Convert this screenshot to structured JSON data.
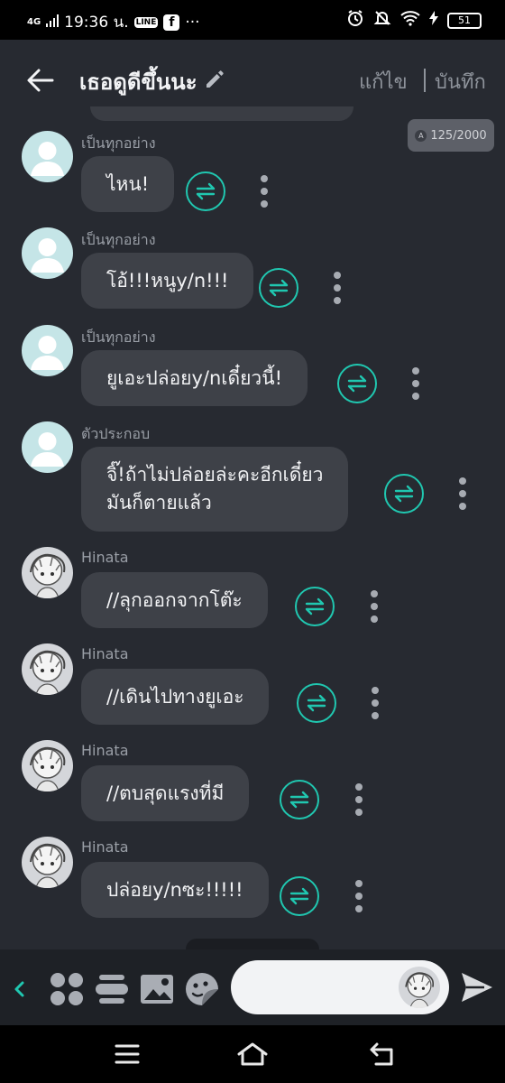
{
  "status_bar": {
    "network": "4G",
    "time": "19:36 น.",
    "line_badge": "LINE",
    "fb_badge": "f",
    "more": "···",
    "battery": "51"
  },
  "header": {
    "title": "เธอดูดีขึ้นนะ",
    "edit_label": "แก้ไข",
    "save_label": "บันทึก"
  },
  "counter": {
    "badge": "A",
    "text": "125/2000"
  },
  "messages": [
    {
      "sender": "เป็นทุกอย่าง",
      "lines": [
        "ไหน!"
      ]
    },
    {
      "sender": "เป็นทุกอย่าง",
      "lines": [
        "โอ้!!!หนูy/n!!!"
      ]
    },
    {
      "sender": "เป็นทุกอย่าง",
      "lines": [
        "ยูเอะปล่อยy/nเดี๋ยวนี้!"
      ]
    },
    {
      "sender": "ตัวประกอบ",
      "lines": [
        "จิ๊!ถ้าไม่ปล่อยล่ะคะอีกเดี๋ยว",
        "มันก็ตายแล้ว"
      ]
    },
    {
      "sender": "Hinata",
      "lines": [
        "//ลุกออกจากโต๊ะ"
      ]
    },
    {
      "sender": "Hinata",
      "lines": [
        "//เดินไปทางยูเอะ"
      ]
    },
    {
      "sender": "Hinata",
      "lines": [
        "//ตบสุดแรงที่มี"
      ]
    },
    {
      "sender": "Hinata",
      "lines": [
        "ปล่อยy/nซะ!!!!!"
      ]
    }
  ],
  "composer": {
    "placeholder": ""
  },
  "colors": {
    "accent": "#20c7b0",
    "background": "#272a31",
    "bubble": "#3e4148"
  }
}
